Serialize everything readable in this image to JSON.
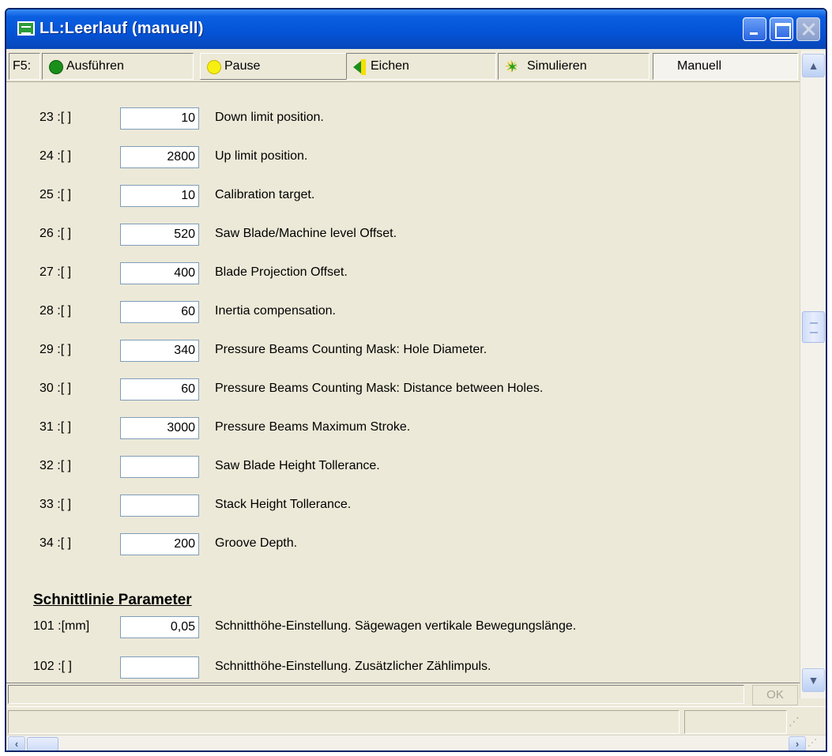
{
  "window": {
    "title": "LL:Leerlauf (manuell)"
  },
  "toolbar": {
    "hotkey": "F5:",
    "run_label": "Ausführen",
    "pause_label": "Pause",
    "calibrate_label": "Eichen",
    "simulate_label": "Simulieren",
    "mode_label": "Manuell"
  },
  "params": [
    {
      "num": "23 :[ ]",
      "value": "10",
      "desc": "Down limit position."
    },
    {
      "num": "24 :[ ]",
      "value": "2800",
      "desc": "Up limit position."
    },
    {
      "num": "25 :[ ]",
      "value": "10",
      "desc": "Calibration target."
    },
    {
      "num": "26 :[ ]",
      "value": "520",
      "desc": "Saw Blade/Machine level Offset."
    },
    {
      "num": "27 :[ ]",
      "value": "400",
      "desc": "Blade Projection Offset."
    },
    {
      "num": "28 :[ ]",
      "value": "60",
      "desc": "Inertia compensation."
    },
    {
      "num": "29 :[ ]",
      "value": "340",
      "desc": "Pressure Beams Counting Mask: Hole Diameter."
    },
    {
      "num": "30 :[ ]",
      "value": "60",
      "desc": "Pressure Beams Counting Mask: Distance between Holes."
    },
    {
      "num": "31 :[ ]",
      "value": "3000",
      "desc": "Pressure Beams Maximum Stroke."
    },
    {
      "num": "32 :[ ]",
      "value": "",
      "desc": "Saw Blade Height Tollerance."
    },
    {
      "num": "33 :[ ]",
      "value": "",
      "desc": "Stack Height Tollerance."
    },
    {
      "num": "34 :[ ]",
      "value": "200",
      "desc": "Groove Depth."
    }
  ],
  "section": {
    "title": "Schnittlinie Parameter"
  },
  "section_params": [
    {
      "num": "101 :[mm]",
      "value": "0,05",
      "desc": "Schnitthöhe-Einstellung. Sägewagen vertikale Bewegungslänge."
    },
    {
      "num": "102 :[ ]",
      "value": "",
      "desc": "Schnitthöhe-Einstellung. Zusätzlicher Zählimpuls."
    }
  ],
  "footer": {
    "ok_label": "OK"
  },
  "icons": {
    "run": "green-circle-icon",
    "pause": "yellow-circle-icon",
    "calibrate": "calibrate-arrow-icon",
    "simulate": "simulate-star-icon"
  }
}
